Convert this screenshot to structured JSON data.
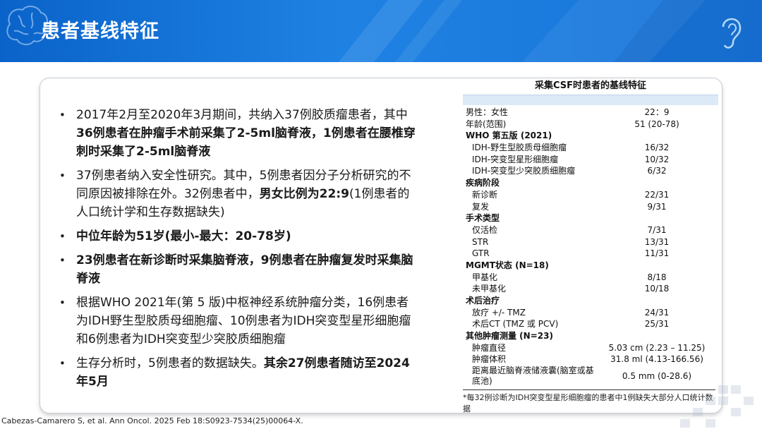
{
  "header": {
    "title": "患者基线特征"
  },
  "colors": {
    "header_blue": "#1874d8",
    "table_header_bar": "#dce9f6"
  },
  "icons": {
    "brain": "brain-icon",
    "ear": "ear-icon"
  },
  "bullets": [
    {
      "parts": [
        {
          "t": "2017年2月至2020年3月期间，共纳入37例胶质瘤患者，其中 ",
          "b": false
        },
        {
          "t": "36例患者在肿瘤手术前采集了2-5ml脑脊液，1例患者在腰椎穿刺时采集了2-5ml脑脊液",
          "b": true
        }
      ]
    },
    {
      "parts": [
        {
          "t": "37例患者纳入安全性研究。其中，5例患者因分子分析研究的不同原因被排除在外。32例患者中，",
          "b": false
        },
        {
          "t": "男女比例为22:9",
          "b": true
        },
        {
          "t": "(1例患者的人口统计学和生存数据缺失)",
          "b": false
        }
      ]
    },
    {
      "parts": [
        {
          "t": "中位年龄为51岁(最小-最大：20-78岁)",
          "b": true
        }
      ]
    },
    {
      "parts": [
        {
          "t": "23例患者在新诊断时采集脑脊液，9例患者在肿瘤复发时采集脑脊液",
          "b": true
        }
      ]
    },
    {
      "parts": [
        {
          "t": "根据WHO 2021年(第 5 版)中枢神经系统肿瘤分类，16例患者为IDH野生型胶质母细胞瘤、10例患者为IDH突变型星形细胞瘤和6例患者为IDH突变型少突胶质细胞瘤",
          "b": false
        }
      ]
    },
    {
      "parts": [
        {
          "t": "生存分析时，5例患者的数据缺失。",
          "b": false
        },
        {
          "t": "其余27例患者随访至2024 年5月",
          "b": true
        }
      ]
    }
  ],
  "table": {
    "title": "采集CSF时患者的基线特征",
    "rows": [
      {
        "label": "男性：女性",
        "value": "22：9",
        "kind": "main"
      },
      {
        "label": "年龄(范围)",
        "value": "51 (20-78)",
        "kind": "main"
      },
      {
        "label": "WHO 第五版 (2021)",
        "value": "",
        "kind": "sec"
      },
      {
        "label": "IDH-野生型胶质母细胞瘤",
        "value": "16/32",
        "kind": "sub"
      },
      {
        "label": "IDH-突变型星形细胞瘤",
        "value": "10/32",
        "kind": "sub"
      },
      {
        "label": "IDH-突变型少突胶质细胞瘤",
        "value": "6/32",
        "kind": "sub"
      },
      {
        "label": "疾病阶段",
        "value": "",
        "kind": "sec"
      },
      {
        "label": "新诊断",
        "value": "22/31",
        "kind": "sub"
      },
      {
        "label": "复发",
        "value": "9/31",
        "kind": "sub"
      },
      {
        "label": "手术类型",
        "value": "",
        "kind": "sec"
      },
      {
        "label": "仅活检",
        "value": "7/31",
        "kind": "sub"
      },
      {
        "label": "STR",
        "value": "13/31",
        "kind": "sub"
      },
      {
        "label": "GTR",
        "value": "11/31",
        "kind": "sub"
      },
      {
        "label": "MGMT状态 (N=18)",
        "value": "",
        "kind": "sec"
      },
      {
        "label": "甲基化",
        "value": "8/18",
        "kind": "sub"
      },
      {
        "label": "未甲基化",
        "value": "10/18",
        "kind": "sub"
      },
      {
        "label": "术后治疗",
        "value": "",
        "kind": "sec"
      },
      {
        "label": "放疗 +/- TMZ",
        "value": "24/31",
        "kind": "sub"
      },
      {
        "label": "术后CT (TMZ 或 PCV)",
        "value": "25/31",
        "kind": "sub"
      },
      {
        "label": "其他肿瘤测量 (N=23)",
        "value": "",
        "kind": "sec"
      },
      {
        "label": "肿瘤直径",
        "value": "5.03 cm (2.23 – 11.25)",
        "kind": "sub"
      },
      {
        "label": "肿瘤体积",
        "value": "31.8 ml (4.13-166.56)",
        "kind": "sub"
      },
      {
        "label": "距离最近脑脊液储液囊(脑室或基底池)",
        "value": "0.5 mm (0-28.6)",
        "kind": "subtall"
      }
    ],
    "footnote": "*每32例诊断为IDH突变型星形细胞瘤的患者中1例缺失大部分人口统计数据"
  },
  "citation": "Cabezas-Camarero S, et al. Ann Oncol. 2025 Feb 18:S0923-7534(25)00064-X."
}
